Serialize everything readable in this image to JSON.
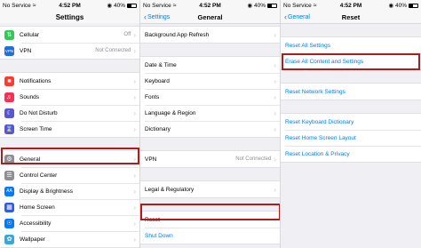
{
  "status": {
    "carrier": "No Service",
    "time": "4:52 PM",
    "battery": "40%"
  },
  "panel1": {
    "title": "Settings",
    "group1": [
      {
        "label": "Cellular",
        "value": "Off",
        "icon": "antenna-icon",
        "color": "#34c759"
      },
      {
        "label": "VPN",
        "value": "Not Connected",
        "icon": "vpn-icon",
        "color": "#1f6fe0"
      }
    ],
    "group2": [
      {
        "label": "Notifications",
        "icon": "notifications-icon",
        "color": "#ff3b30"
      },
      {
        "label": "Sounds",
        "icon": "speaker-icon",
        "color": "#ff2d55"
      },
      {
        "label": "Do Not Disturb",
        "icon": "moon-icon",
        "color": "#5856d6"
      },
      {
        "label": "Screen Time",
        "icon": "hourglass-icon",
        "color": "#5856d6"
      }
    ],
    "group3": [
      {
        "label": "General",
        "icon": "gear-icon",
        "color": "#8e8e93"
      },
      {
        "label": "Control Center",
        "icon": "control-center-icon",
        "color": "#8e8e93"
      },
      {
        "label": "Display & Brightness",
        "icon": "display-icon",
        "color": "#007aff"
      },
      {
        "label": "Home Screen",
        "icon": "home-screen-icon",
        "color": "#2f5bea"
      },
      {
        "label": "Accessibility",
        "icon": "accessibility-icon",
        "color": "#007aff"
      },
      {
        "label": "Wallpaper",
        "icon": "wallpaper-icon",
        "color": "#34aadc"
      }
    ]
  },
  "panel2": {
    "back": "Settings",
    "title": "General",
    "group1": [
      "Background App Refresh"
    ],
    "group2": [
      "Date & Time",
      "Keyboard",
      "Fonts",
      "Language & Region",
      "Dictionary"
    ],
    "vpn": {
      "label": "VPN",
      "value": "Not Connected"
    },
    "group4": [
      "Legal & Regulatory"
    ],
    "reset": "Reset",
    "shutdown": "Shut Down"
  },
  "panel3": {
    "back": "General",
    "title": "Reset",
    "group1": [
      "Reset All Settings",
      "Erase All Content and Settings"
    ],
    "group2": [
      "Reset Network Settings"
    ],
    "group3": [
      "Reset Keyboard Dictionary",
      "Reset Home Screen Layout",
      "Reset Location & Privacy"
    ]
  },
  "colors": {
    "highlight": "#b31b1b",
    "link": "#007aff"
  }
}
